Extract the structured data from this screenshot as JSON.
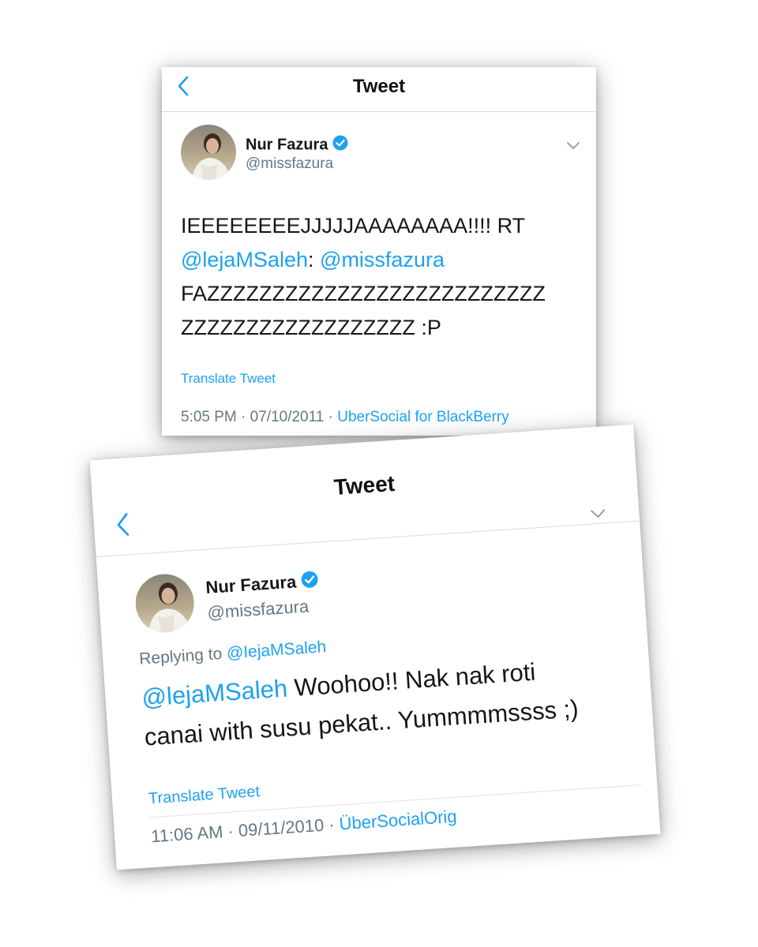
{
  "tweet_1": {
    "header": {
      "title": "Tweet",
      "back_icon": "chevron-left-icon"
    },
    "author": {
      "name": "Nur Fazura",
      "handle": "@missfazura",
      "verified": true
    },
    "body": {
      "line1": "IEEEEEEEEJJJJJAAAAAAAA!!!! RT",
      "mention1": "@lejaMSaleh",
      "colon": ":",
      "mention2": "@missfazura",
      "line3": "FAZZZZZZZZZZZZZZZZZZZZZZZZZZ",
      "line4": "ZZZZZZZZZZZZZZZZZZ :P"
    },
    "translate_label": "Translate Tweet",
    "meta": {
      "time": "5:05 PM",
      "sep1": " · ",
      "date": "07/10/2011",
      "sep2": " · ",
      "source": "UberSocial for BlackBerry"
    }
  },
  "tweet_2": {
    "header": {
      "title": "Tweet",
      "back_icon": "chevron-left-icon"
    },
    "author": {
      "name": "Nur Fazura",
      "handle": "@missfazura",
      "verified": true
    },
    "replying_prefix": "Replying to ",
    "replying_to": "@IejaMSaleh",
    "body": {
      "mention": "@lejaMSaleh",
      "line1_rest": " Woohoo!! Nak nak roti",
      "line2": "canai with susu pekat.. Yummmmssss ;)"
    },
    "translate_label": "Translate Tweet",
    "meta": {
      "time": "11:06 AM",
      "sep1": " · ",
      "date": "09/11/2010",
      "sep2": " · ",
      "source": "ÜberSocialOrig"
    }
  },
  "colors": {
    "link": "#1da1f2",
    "secondary_text": "#657786",
    "primary_text": "#14171a"
  }
}
